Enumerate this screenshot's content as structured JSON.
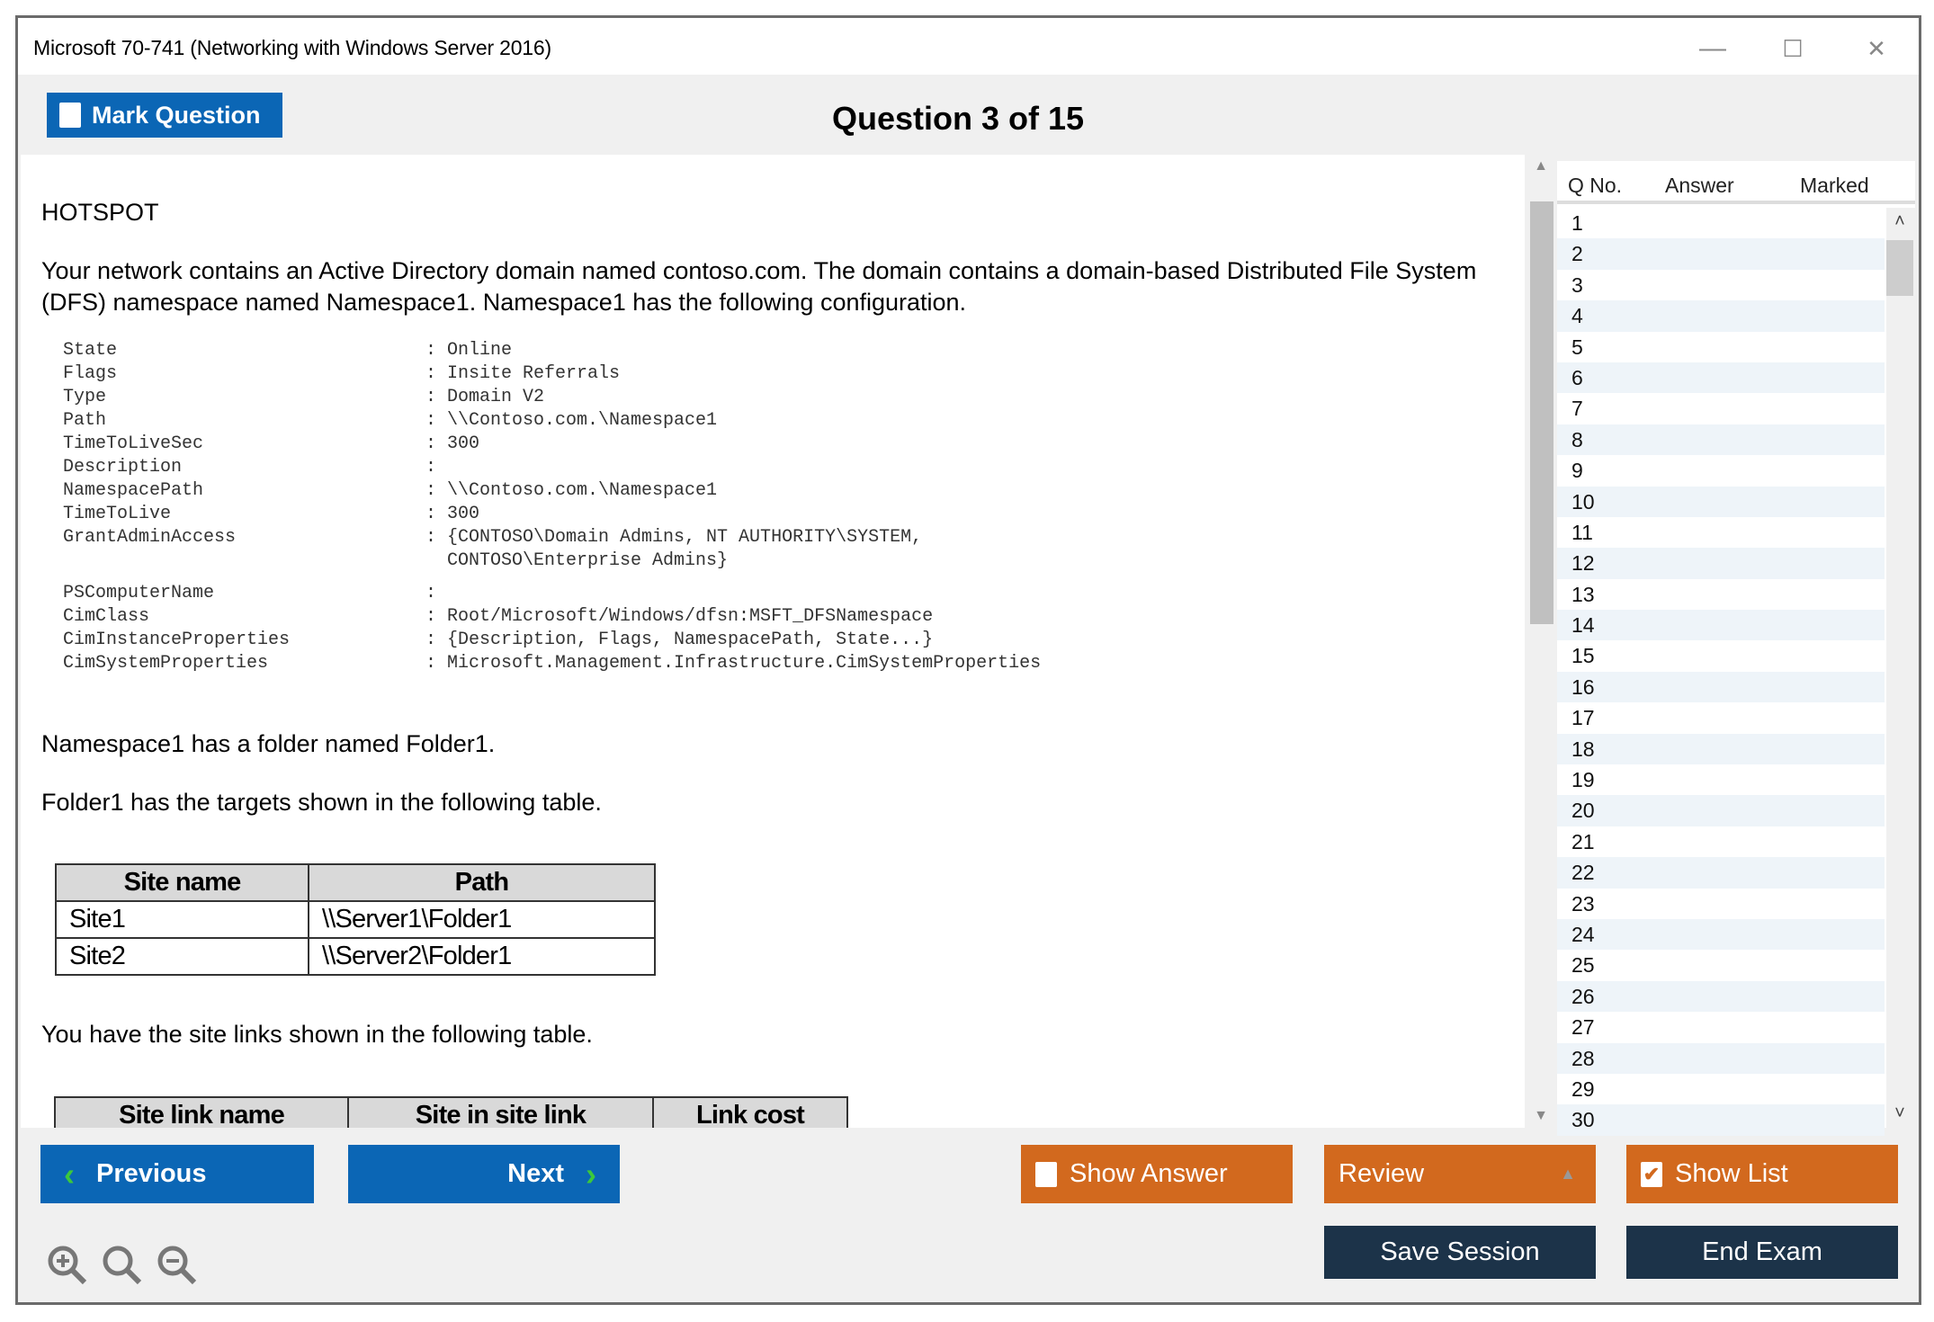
{
  "window": {
    "title": "Microsoft 70-741 (Networking with Windows Server 2016)",
    "controls": {
      "minimize": "—",
      "maximize": "☐",
      "close": "✕"
    }
  },
  "toolbar": {
    "mark_question": "Mark Question",
    "question_title": "Question 3 of 15"
  },
  "question": {
    "type_label": "HOTSPOT",
    "intro": "Your network contains an Active Directory domain named contoso.com. The domain contains a domain-based Distributed File System (DFS) namespace named Namespace1. Namespace1 has the following configuration.",
    "config": [
      {
        "key": "State",
        "value": ": Online"
      },
      {
        "key": "Flags",
        "value": ": Insite Referrals"
      },
      {
        "key": "Type",
        "value": ": Domain V2"
      },
      {
        "key": "Path",
        "value": ": \\\\Contoso.com.\\Namespace1"
      },
      {
        "key": "TimeToLiveSec",
        "value": ": 300"
      },
      {
        "key": "Description",
        "value": ":"
      },
      {
        "key": "NamespacePath",
        "value": ": \\\\Contoso.com.\\Namespace1"
      },
      {
        "key": "TimeToLive",
        "value": ": 300"
      },
      {
        "key": "GrantAdminAccess",
        "value": ": {CONTOSO\\Domain Admins, NT AUTHORITY\\SYSTEM,"
      },
      {
        "key": "",
        "value": "  CONTOSO\\Enterprise Admins}"
      },
      {
        "key": "PSComputerName",
        "value": ":"
      },
      {
        "key": "CimClass",
        "value": ": Root/Microsoft/Windows/dfsn:MSFT_DFSNamespace"
      },
      {
        "key": "CimInstanceProperties",
        "value": ": {Description, Flags, NamespacePath, State...}"
      },
      {
        "key": "CimSystemProperties",
        "value": ": Microsoft.Management.Infrastructure.CimSystemProperties"
      }
    ],
    "folder_text": "Namespace1 has a folder named Folder1.",
    "targets_text": "Folder1 has the targets shown in the following table.",
    "targets_table": {
      "headers": [
        "Site name",
        "Path"
      ],
      "rows": [
        [
          "Site1",
          "\\\\Server1\\Folder1"
        ],
        [
          "Site2",
          "\\\\Server2\\Folder1"
        ]
      ]
    },
    "sitelinks_text": "You have the site links shown in the following table.",
    "sitelinks_table": {
      "headers": [
        "Site link name",
        "Site in site link",
        "Link cost"
      ]
    }
  },
  "question_list": {
    "headers": [
      "Q No.",
      "Answer",
      "Marked"
    ],
    "numbers": [
      "1",
      "2",
      "3",
      "4",
      "5",
      "6",
      "7",
      "8",
      "9",
      "10",
      "11",
      "12",
      "13",
      "14",
      "15",
      "16",
      "17",
      "18",
      "19",
      "20",
      "21",
      "22",
      "23",
      "24",
      "25",
      "26",
      "27",
      "28",
      "29",
      "30"
    ]
  },
  "buttons": {
    "previous": "Previous",
    "next": "Next",
    "show_answer": "Show Answer",
    "review": "Review",
    "show_list": "Show List",
    "save_session": "Save Session",
    "end_exam": "End Exam"
  },
  "colors": {
    "blue": "#0b66b5",
    "orange": "#d2691e",
    "navy": "#1c3349"
  }
}
